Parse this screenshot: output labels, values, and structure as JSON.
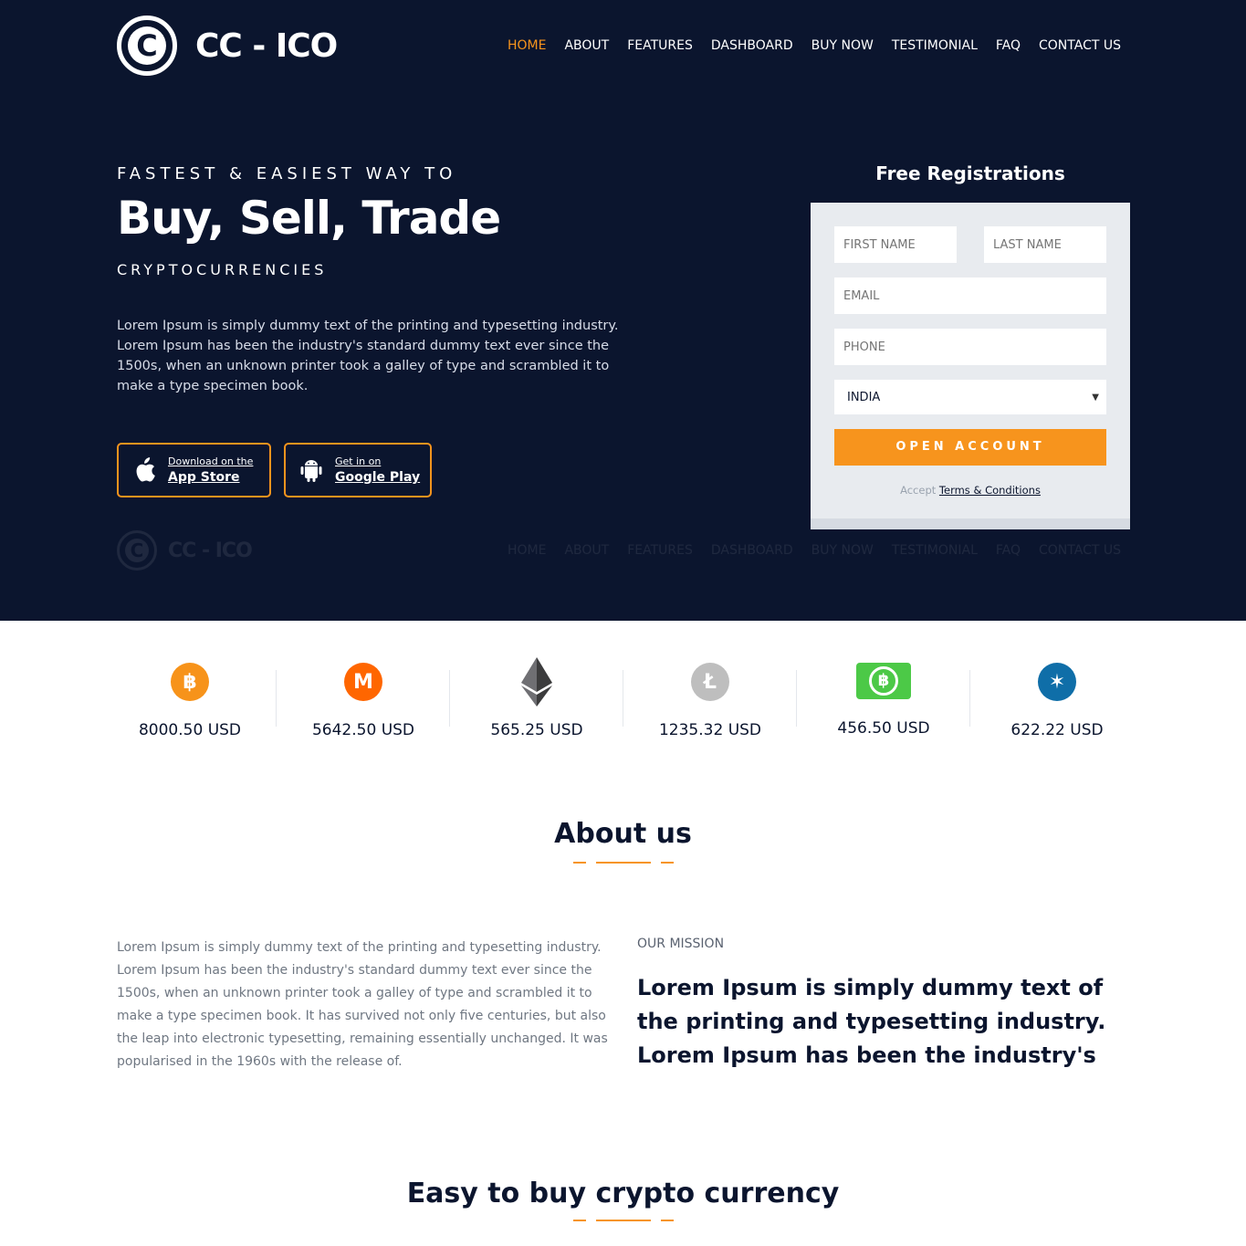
{
  "brand": {
    "name": "CC - ICO",
    "logo_letter": "C"
  },
  "nav": [
    {
      "label": "HOME",
      "active": true
    },
    {
      "label": "ABOUT",
      "active": false
    },
    {
      "label": "FEATURES",
      "active": false
    },
    {
      "label": "DASHBOARD",
      "active": false
    },
    {
      "label": "BUY NOW",
      "active": false
    },
    {
      "label": "TESTIMONIAL",
      "active": false
    },
    {
      "label": "FAQ",
      "active": false
    },
    {
      "label": "CONTACT US",
      "active": false
    }
  ],
  "hero": {
    "kicker": "FASTEST & EASIEST WAY TO",
    "headline": "Buy, Sell, Trade",
    "subhead": "CRYPTOCURRENCIES",
    "description": "Lorem Ipsum is simply dummy text of the printing and typesetting industry. Lorem Ipsum has been the industry's standard dummy text ever since the 1500s, when an unknown printer took a galley of type and scrambled it to make a type specimen book.",
    "app_store": {
      "small": "Download on the",
      "big": "App Store",
      "icon": "apple-icon"
    },
    "google_play": {
      "small": "Get in on",
      "big": "Google Play",
      "icon": "android-icon"
    }
  },
  "registration": {
    "title": "Free Registrations",
    "first_name_placeholder": "FIRST NAME",
    "last_name_placeholder": "LAST NAME",
    "email_placeholder": "EMAIL",
    "phone_placeholder": "PHONE",
    "country_value": "INDIA",
    "submit_label": "OPEN ACCOUNT",
    "terms_prefix": "Accept",
    "terms_link": "Terms & Conditions"
  },
  "prices": [
    {
      "coin": "bitcoin-icon",
      "symbol": "฿",
      "value": "8000.50 USD",
      "color": "#f7931a"
    },
    {
      "coin": "monero-icon",
      "symbol": "M",
      "value": "5642.50 USD",
      "color": "#ff6600"
    },
    {
      "coin": "ethereum-icon",
      "symbol": "◆",
      "value": "565.25 USD",
      "color": "#3c3c3d"
    },
    {
      "coin": "litecoin-icon",
      "symbol": "Ł",
      "value": "1235.32 USD",
      "color": "#bebebe"
    },
    {
      "coin": "bitcoin-cash-icon",
      "symbol": "฿",
      "value": "456.50 USD",
      "color": "#4cc947"
    },
    {
      "coin": "ripple-icon",
      "symbol": "✶",
      "value": "622.22 USD",
      "color": "#0f6ea8"
    }
  ],
  "about": {
    "title": "About us",
    "body": "Lorem Ipsum is simply dummy text of the printing and typesetting industry. Lorem Ipsum has been the industry's standard dummy text ever since the 1500s, when an unknown printer took a galley of type and scrambled it to make a type specimen book. It has survived not only five centuries, but also the leap into electronic typesetting, remaining essentially unchanged. It was popularised in the 1960s with the release of.",
    "mission_kicker": "OUR MISSION",
    "mission_text": "Lorem Ipsum is simply dummy text of the printing and typesetting industry. Lorem Ipsum has been the industry's"
  },
  "buy": {
    "title": "Easy to buy crypto currency"
  },
  "colors": {
    "navy": "#0b152e",
    "accent": "#f7941d",
    "panel": "#e8ebef"
  }
}
